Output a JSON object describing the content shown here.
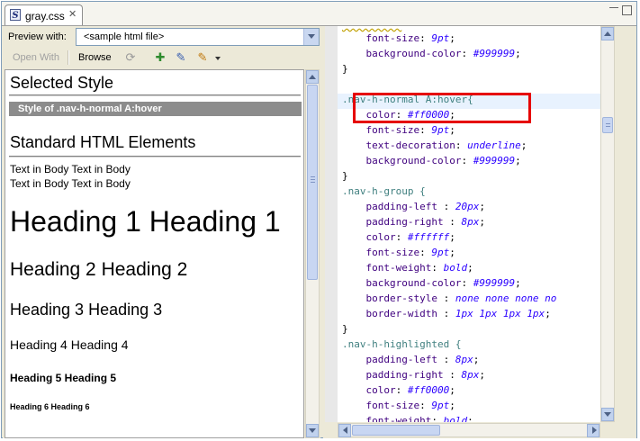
{
  "tab": {
    "title": "gray.css",
    "close_glyph": "✕",
    "icon": "css-file-icon"
  },
  "preview": {
    "label": "Preview with:",
    "selected": "<sample html file>",
    "toolbar": {
      "open_with": "Open With",
      "browse": "Browse"
    }
  },
  "rendered": {
    "selected_style_heading": "Selected Style",
    "style_bar": "Style of .nav-h-normal A:hover",
    "standard_heading": "Standard HTML Elements",
    "body_line1": "Text in Body Text in Body",
    "body_line2": "Text in Body Text in Body",
    "h1": "Heading 1 Heading 1",
    "h2": "Heading 2 Heading 2",
    "h3": "Heading 3 Heading 3",
    "h4": "Heading 4 Heading 4",
    "h5": "Heading 5 Heading 5",
    "h6": "Heading 6 Heading 6"
  },
  "code": {
    "l1": {
      "prop": "font-size",
      "val": "9pt"
    },
    "l2": {
      "prop": "background-color",
      "val": "#999999"
    },
    "l3": "}",
    "l5": ".nav-h-normal A:hover{",
    "l6": {
      "prop": "color",
      "val": "#ff0000"
    },
    "l7": {
      "prop": "font-size",
      "val": "9pt"
    },
    "l8": {
      "prop": "text-decoration",
      "val": "underline"
    },
    "l9": {
      "prop": "background-color",
      "val": "#999999"
    },
    "l10": "}",
    "l11": ".nav-h-group {",
    "l12": {
      "prop": "padding-left ",
      "val": "20px"
    },
    "l13": {
      "prop": "padding-right ",
      "val": "8px"
    },
    "l14": {
      "prop": "color",
      "val": "#ffffff"
    },
    "l15": {
      "prop": "font-size",
      "val": "9pt"
    },
    "l16": {
      "prop": "font-weight",
      "val": "bold"
    },
    "l17": {
      "prop": "background-color",
      "val": "#999999"
    },
    "l18": {
      "prop": "border-style ",
      "val": "none none none no"
    },
    "l19": {
      "prop": "border-width ",
      "val": "1px 1px 1px 1px"
    },
    "l20": "}",
    "l21": ".nav-h-highlighted {",
    "l22": {
      "prop": "padding-left ",
      "val": "8px"
    },
    "l23": {
      "prop": "padding-right ",
      "val": "8px"
    },
    "l24": {
      "prop": "color",
      "val": "#ff0000"
    },
    "l25": {
      "prop": "font-size",
      "val": "9pt"
    },
    "l26": {
      "prop": "font-weight",
      "val": "bold"
    }
  },
  "colors": {
    "highlight_box": "#e60000",
    "selector": "#3f7f7f",
    "property": "#3f007f",
    "value": "#2a00ff"
  }
}
